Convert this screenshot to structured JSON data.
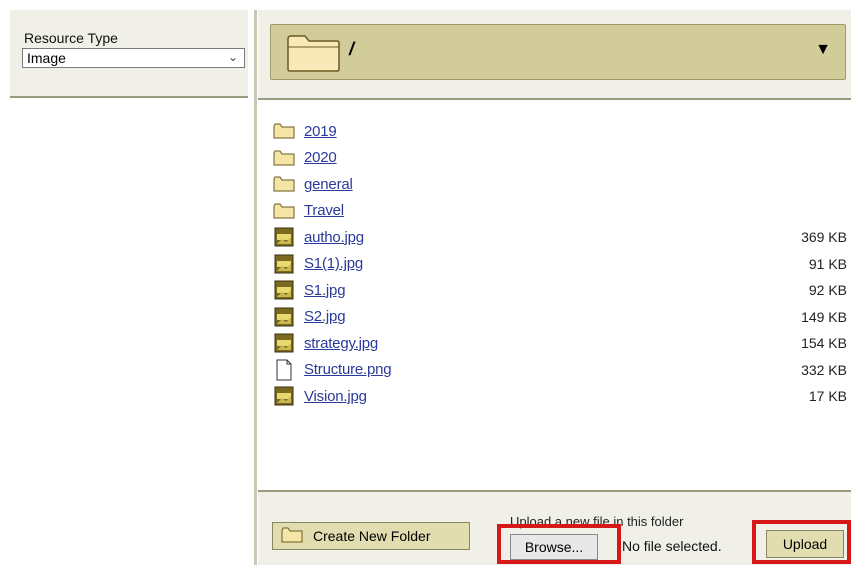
{
  "resource": {
    "label": "Resource Type",
    "selected": "Image"
  },
  "path": {
    "current": "/"
  },
  "files": [
    {
      "name": "2019",
      "type": "folder",
      "size": ""
    },
    {
      "name": "2020",
      "type": "folder",
      "size": ""
    },
    {
      "name": "general",
      "type": "folder",
      "size": ""
    },
    {
      "name": "Travel",
      "type": "folder",
      "size": ""
    },
    {
      "name": "autho.jpg",
      "type": "jpg",
      "size": "369 KB"
    },
    {
      "name": "S1(1).jpg",
      "type": "jpg",
      "size": "91 KB"
    },
    {
      "name": "S1.jpg",
      "type": "jpg",
      "size": "92 KB"
    },
    {
      "name": "S2.jpg",
      "type": "jpg",
      "size": "149 KB"
    },
    {
      "name": "strategy.jpg",
      "type": "jpg",
      "size": "154 KB"
    },
    {
      "name": "Structure.png",
      "type": "file",
      "size": "332 KB"
    },
    {
      "name": "Vision.jpg",
      "type": "jpg",
      "size": "17 KB"
    }
  ],
  "toolbar": {
    "create_folder": "Create New Folder",
    "upload_caption": "Upload a new file in this folder",
    "browse": "Browse...",
    "no_file": "No file selected.",
    "upload": "Upload"
  },
  "colors": {
    "panel_bg": "#f0f0e8",
    "path_bar": "#d2cc9a",
    "link": "#2a3a9a",
    "highlight": "#d81818",
    "folder": "#f5e6a8"
  }
}
